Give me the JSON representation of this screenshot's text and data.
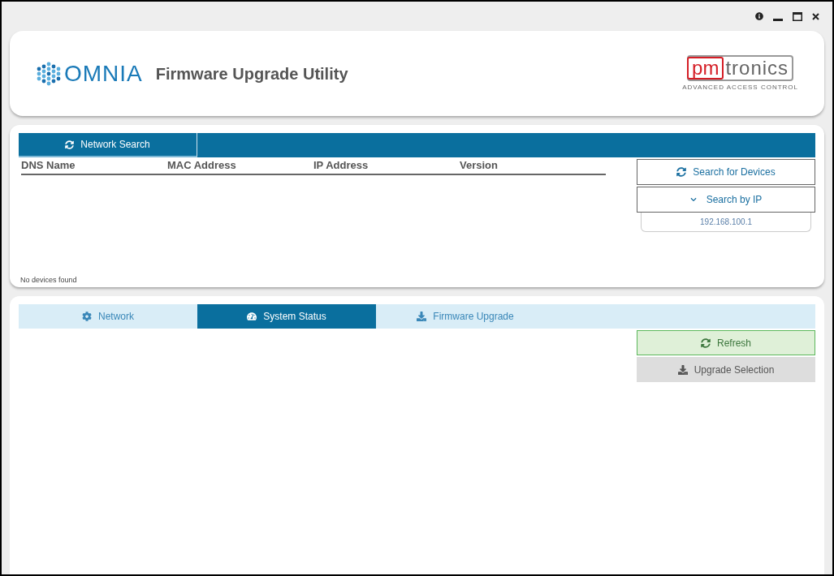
{
  "app": {
    "logo_text": "OMNIA",
    "title": "Firmware Upgrade Utility",
    "brand": {
      "part_1": "pm",
      "part_2": "tronics",
      "tagline": "ADVANCED ACCESS CONTROL"
    }
  },
  "search_panel": {
    "tab": {
      "label": "Network Search",
      "selected": true
    },
    "columns": [
      "DNS Name",
      "MAC Address",
      "IP Address",
      "Version"
    ],
    "status": "No devices found",
    "search_button": "Search for Devices",
    "search_by_ip": {
      "label": "Search by IP",
      "expanded": true,
      "value": "192.168.100.1"
    }
  },
  "device_panel": {
    "tabs": [
      {
        "label": "Network",
        "selected": false
      },
      {
        "label": "System Status",
        "selected": true
      },
      {
        "label": "Firmware Upgrade",
        "selected": false
      }
    ],
    "buttons": [
      {
        "label": "Refresh",
        "kind": "success"
      },
      {
        "label": "Upgrade Selection",
        "kind": "neutral"
      }
    ]
  }
}
